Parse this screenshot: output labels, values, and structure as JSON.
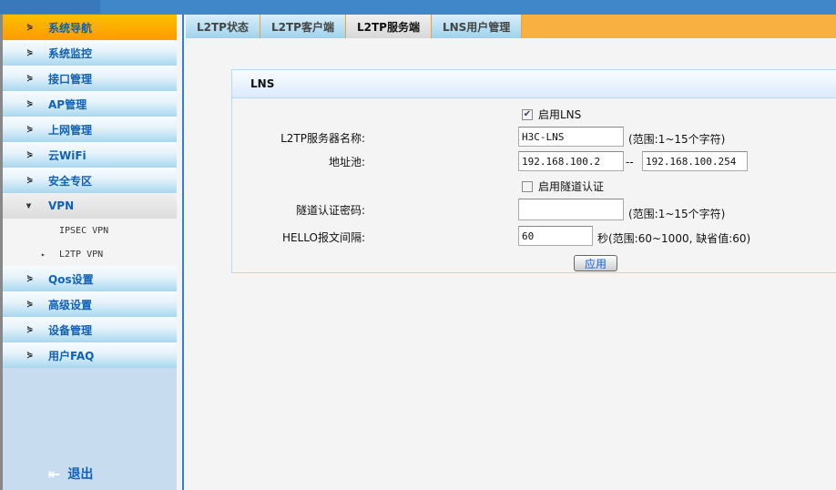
{
  "sidebar": {
    "items": [
      {
        "label": "系统导航",
        "state": "active"
      },
      {
        "label": "系统监控"
      },
      {
        "label": "接口管理"
      },
      {
        "label": "AP管理"
      },
      {
        "label": "上网管理"
      },
      {
        "label": "云WiFi"
      },
      {
        "label": "安全专区"
      },
      {
        "label": "VPN",
        "state": "expanded",
        "children": [
          {
            "label": "IPSEC VPN"
          },
          {
            "label": "L2TP VPN",
            "state": "selected"
          }
        ]
      },
      {
        "label": "Qos设置"
      },
      {
        "label": "高级设置"
      },
      {
        "label": "设备管理"
      },
      {
        "label": "用户FAQ"
      }
    ],
    "logout": "退出"
  },
  "tabs": [
    {
      "label": "L2TP状态"
    },
    {
      "label": "L2TP客户端"
    },
    {
      "label": "L2TP服务端",
      "selected": true
    },
    {
      "label": "LNS用户管理"
    }
  ],
  "panel": {
    "title": "LNS",
    "enable_lns": {
      "label": "启用LNS",
      "checked": true
    },
    "server_name": {
      "label": "L2TP服务器名称:",
      "value": "H3C-LNS",
      "hint": "(范围:1~15个字符)"
    },
    "pool": {
      "label": "地址池:",
      "start": "192.168.100.2",
      "sep": "--",
      "end": "192.168.100.254"
    },
    "tunnel_auth": {
      "label": "启用隧道认证",
      "checked": false
    },
    "tunnel_password": {
      "label": "隧道认证密码:",
      "value": "",
      "hint": "(范围:1~15个字符)"
    },
    "hello": {
      "label": "HELLO报文间隔:",
      "value": "60",
      "hint": "秒(范围:60~1000, 缺省值:60)"
    },
    "apply": "应用"
  }
}
